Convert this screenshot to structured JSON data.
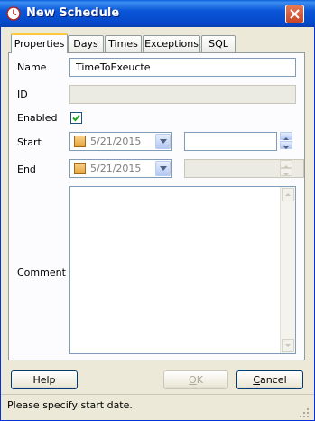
{
  "window": {
    "title": "New Schedule"
  },
  "tabs": [
    {
      "label": "Properties",
      "active": true
    },
    {
      "label": "Days",
      "active": false
    },
    {
      "label": "Times",
      "active": false
    },
    {
      "label": "Exceptions",
      "active": false
    },
    {
      "label": "SQL",
      "active": false
    }
  ],
  "form": {
    "name_label": "Name",
    "name_value": "TimeToExeucte",
    "id_label": "ID",
    "id_value": "",
    "enabled_label": "Enabled",
    "enabled_checked": true,
    "start_label": "Start",
    "start_date": "5/21/2015",
    "start_time": "",
    "end_label": "End",
    "end_date": "5/21/2015",
    "end_time": "",
    "comment_label": "Comment",
    "comment_value": ""
  },
  "buttons": {
    "help": "Help",
    "ok": "OK",
    "cancel": "Cancel"
  },
  "status": {
    "text": "Please specify start date."
  },
  "colors": {
    "title_bar": "#0a56d8",
    "close_button": "#c9462a",
    "active_tab_accent": "#ffc83c"
  }
}
